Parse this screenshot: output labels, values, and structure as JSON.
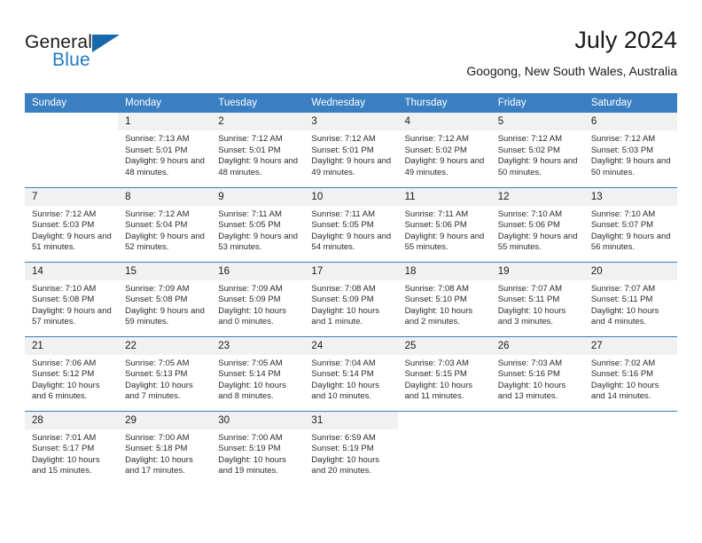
{
  "brand": {
    "name_part1": "General",
    "name_part2": "Blue",
    "flag_icon": "triangle-flag-icon"
  },
  "header": {
    "title": "July 2024",
    "location": "Googong, New South Wales, Australia"
  },
  "theme": {
    "header_blue": "#3a7fc1",
    "brand_blue": "#1f7ac4",
    "daynum_band": "#f1f1f1",
    "text": "#222222"
  },
  "weekday_headers": [
    "Sunday",
    "Monday",
    "Tuesday",
    "Wednesday",
    "Thursday",
    "Friday",
    "Saturday"
  ],
  "weeks": [
    [
      {
        "day": "",
        "sunrise": "",
        "sunset": "",
        "daylight": "",
        "empty": true
      },
      {
        "day": "1",
        "sunrise": "Sunrise: 7:13 AM",
        "sunset": "Sunset: 5:01 PM",
        "daylight": "Daylight: 9 hours and 48 minutes."
      },
      {
        "day": "2",
        "sunrise": "Sunrise: 7:12 AM",
        "sunset": "Sunset: 5:01 PM",
        "daylight": "Daylight: 9 hours and 48 minutes."
      },
      {
        "day": "3",
        "sunrise": "Sunrise: 7:12 AM",
        "sunset": "Sunset: 5:01 PM",
        "daylight": "Daylight: 9 hours and 49 minutes."
      },
      {
        "day": "4",
        "sunrise": "Sunrise: 7:12 AM",
        "sunset": "Sunset: 5:02 PM",
        "daylight": "Daylight: 9 hours and 49 minutes."
      },
      {
        "day": "5",
        "sunrise": "Sunrise: 7:12 AM",
        "sunset": "Sunset: 5:02 PM",
        "daylight": "Daylight: 9 hours and 50 minutes."
      },
      {
        "day": "6",
        "sunrise": "Sunrise: 7:12 AM",
        "sunset": "Sunset: 5:03 PM",
        "daylight": "Daylight: 9 hours and 50 minutes."
      }
    ],
    [
      {
        "day": "7",
        "sunrise": "Sunrise: 7:12 AM",
        "sunset": "Sunset: 5:03 PM",
        "daylight": "Daylight: 9 hours and 51 minutes."
      },
      {
        "day": "8",
        "sunrise": "Sunrise: 7:12 AM",
        "sunset": "Sunset: 5:04 PM",
        "daylight": "Daylight: 9 hours and 52 minutes."
      },
      {
        "day": "9",
        "sunrise": "Sunrise: 7:11 AM",
        "sunset": "Sunset: 5:05 PM",
        "daylight": "Daylight: 9 hours and 53 minutes."
      },
      {
        "day": "10",
        "sunrise": "Sunrise: 7:11 AM",
        "sunset": "Sunset: 5:05 PM",
        "daylight": "Daylight: 9 hours and 54 minutes."
      },
      {
        "day": "11",
        "sunrise": "Sunrise: 7:11 AM",
        "sunset": "Sunset: 5:06 PM",
        "daylight": "Daylight: 9 hours and 55 minutes."
      },
      {
        "day": "12",
        "sunrise": "Sunrise: 7:10 AM",
        "sunset": "Sunset: 5:06 PM",
        "daylight": "Daylight: 9 hours and 55 minutes."
      },
      {
        "day": "13",
        "sunrise": "Sunrise: 7:10 AM",
        "sunset": "Sunset: 5:07 PM",
        "daylight": "Daylight: 9 hours and 56 minutes."
      }
    ],
    [
      {
        "day": "14",
        "sunrise": "Sunrise: 7:10 AM",
        "sunset": "Sunset: 5:08 PM",
        "daylight": "Daylight: 9 hours and 57 minutes."
      },
      {
        "day": "15",
        "sunrise": "Sunrise: 7:09 AM",
        "sunset": "Sunset: 5:08 PM",
        "daylight": "Daylight: 9 hours and 59 minutes."
      },
      {
        "day": "16",
        "sunrise": "Sunrise: 7:09 AM",
        "sunset": "Sunset: 5:09 PM",
        "daylight": "Daylight: 10 hours and 0 minutes."
      },
      {
        "day": "17",
        "sunrise": "Sunrise: 7:08 AM",
        "sunset": "Sunset: 5:09 PM",
        "daylight": "Daylight: 10 hours and 1 minute."
      },
      {
        "day": "18",
        "sunrise": "Sunrise: 7:08 AM",
        "sunset": "Sunset: 5:10 PM",
        "daylight": "Daylight: 10 hours and 2 minutes."
      },
      {
        "day": "19",
        "sunrise": "Sunrise: 7:07 AM",
        "sunset": "Sunset: 5:11 PM",
        "daylight": "Daylight: 10 hours and 3 minutes."
      },
      {
        "day": "20",
        "sunrise": "Sunrise: 7:07 AM",
        "sunset": "Sunset: 5:11 PM",
        "daylight": "Daylight: 10 hours and 4 minutes."
      }
    ],
    [
      {
        "day": "21",
        "sunrise": "Sunrise: 7:06 AM",
        "sunset": "Sunset: 5:12 PM",
        "daylight": "Daylight: 10 hours and 6 minutes."
      },
      {
        "day": "22",
        "sunrise": "Sunrise: 7:05 AM",
        "sunset": "Sunset: 5:13 PM",
        "daylight": "Daylight: 10 hours and 7 minutes."
      },
      {
        "day": "23",
        "sunrise": "Sunrise: 7:05 AM",
        "sunset": "Sunset: 5:14 PM",
        "daylight": "Daylight: 10 hours and 8 minutes."
      },
      {
        "day": "24",
        "sunrise": "Sunrise: 7:04 AM",
        "sunset": "Sunset: 5:14 PM",
        "daylight": "Daylight: 10 hours and 10 minutes."
      },
      {
        "day": "25",
        "sunrise": "Sunrise: 7:03 AM",
        "sunset": "Sunset: 5:15 PM",
        "daylight": "Daylight: 10 hours and 11 minutes."
      },
      {
        "day": "26",
        "sunrise": "Sunrise: 7:03 AM",
        "sunset": "Sunset: 5:16 PM",
        "daylight": "Daylight: 10 hours and 13 minutes."
      },
      {
        "day": "27",
        "sunrise": "Sunrise: 7:02 AM",
        "sunset": "Sunset: 5:16 PM",
        "daylight": "Daylight: 10 hours and 14 minutes."
      }
    ],
    [
      {
        "day": "28",
        "sunrise": "Sunrise: 7:01 AM",
        "sunset": "Sunset: 5:17 PM",
        "daylight": "Daylight: 10 hours and 15 minutes."
      },
      {
        "day": "29",
        "sunrise": "Sunrise: 7:00 AM",
        "sunset": "Sunset: 5:18 PM",
        "daylight": "Daylight: 10 hours and 17 minutes."
      },
      {
        "day": "30",
        "sunrise": "Sunrise: 7:00 AM",
        "sunset": "Sunset: 5:19 PM",
        "daylight": "Daylight: 10 hours and 19 minutes."
      },
      {
        "day": "31",
        "sunrise": "Sunrise: 6:59 AM",
        "sunset": "Sunset: 5:19 PM",
        "daylight": "Daylight: 10 hours and 20 minutes."
      },
      {
        "day": "",
        "sunrise": "",
        "sunset": "",
        "daylight": "",
        "empty": true
      },
      {
        "day": "",
        "sunrise": "",
        "sunset": "",
        "daylight": "",
        "empty": true
      },
      {
        "day": "",
        "sunrise": "",
        "sunset": "",
        "daylight": "",
        "empty": true
      }
    ]
  ]
}
